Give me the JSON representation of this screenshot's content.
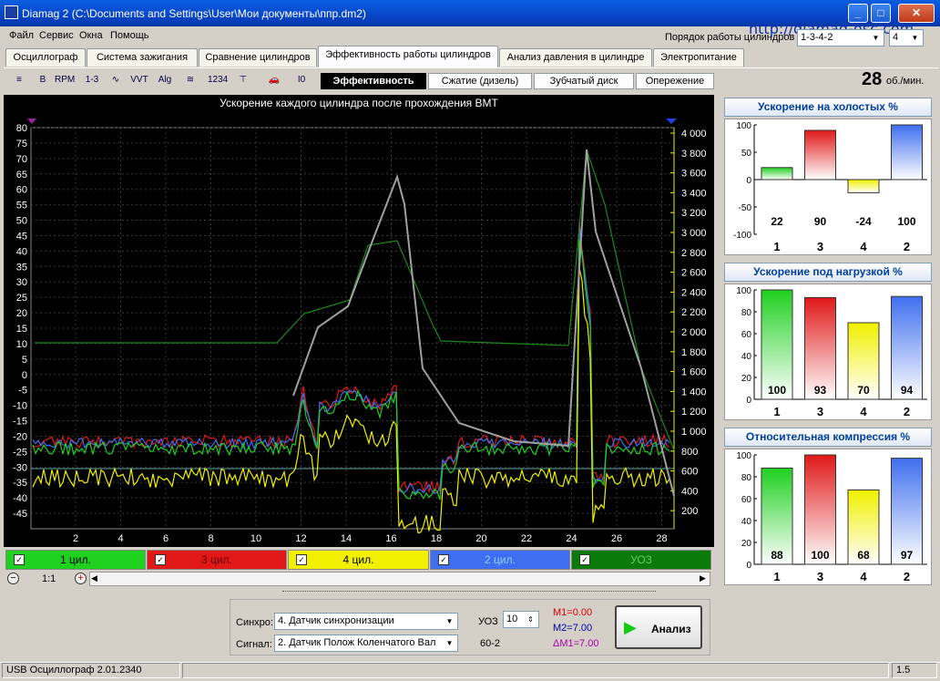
{
  "window": {
    "title": "Diamag 2 (C:\\Documents and Settings\\User\\Мои документы\\ппр.dm2)",
    "minimize": "_",
    "maximize": "□",
    "close": "✕"
  },
  "menu": [
    "Файл",
    "Сервис",
    "Окна",
    "Помощь"
  ],
  "site_link": "http://diamag-osc.com",
  "firing_order": {
    "label": "Порядок работы цилиндров",
    "value": "1-3-4-2",
    "count": "4"
  },
  "tabs": [
    "Осциллограф",
    "Система зажигания",
    "Сравнение цилиндров",
    "Эффективность работы цилиндров",
    "Анализ давления в цилиндре",
    "Электропитание"
  ],
  "active_tab": 3,
  "toolbar": {
    "tools": [
      "≡",
      "B",
      "RPM",
      "1-3",
      "∿",
      "VVT",
      "Alg",
      "≋",
      "1234",
      "⊤",
      "🚗",
      "I0"
    ]
  },
  "subtabs": [
    "Эффективность",
    "Сжатие (дизель)",
    "Зубчатый диск",
    "Опережение"
  ],
  "rpm": {
    "value": "28",
    "unit": "об./мин."
  },
  "plot": {
    "title": "Ускорение каждого цилиндра после прохождения ВМТ",
    "left_ticks": [
      "80",
      "75",
      "70",
      "65",
      "60",
      "55",
      "50",
      "45",
      "40",
      "35",
      "30",
      "25",
      "20",
      "15",
      "10",
      "5",
      "0",
      "-5",
      "-10",
      "-15",
      "-20",
      "-25",
      "-30",
      "-35",
      "-40",
      "-45"
    ],
    "right_ticks": [
      "4 000",
      "3 800",
      "3 600",
      "3 400",
      "3 200",
      "3 000",
      "2 800",
      "2 600",
      "2 400",
      "2 200",
      "2 000",
      "1 800",
      "1 600",
      "1 400",
      "1 200",
      "1 000",
      "800",
      "600",
      "400",
      "200"
    ],
    "x_ticks": [
      "2",
      "4",
      "6",
      "8",
      "10",
      "12",
      "14",
      "16",
      "18",
      "20",
      "22",
      "24",
      "26",
      "28"
    ]
  },
  "channels": [
    {
      "label": "1 цил.",
      "color": "#1fd01f"
    },
    {
      "label": "3 цил.",
      "color": "#e01818"
    },
    {
      "label": "4 цил.",
      "color": "#f0f000"
    },
    {
      "label": "2 цил.",
      "color": "#3f6ff0"
    },
    {
      "label": "УОЗ",
      "color": "#0a7a0a"
    }
  ],
  "zoom": "1:1",
  "controls": {
    "sync_label": "Синхро:",
    "sync_value": "4. Датчик синхронизации",
    "signal_label": "Сигнал:",
    "signal_value": "2. Датчик Полож Коленчатого Вал",
    "uoz_label": "УОЗ",
    "uoz_value": "10",
    "teeth": "60-2",
    "m1": "M1=0.00",
    "m2": "M2=7.00",
    "dm1": "ΔM1=7.00",
    "analyze": "Анализ"
  },
  "chart_data": [
    {
      "type": "bar",
      "title": "Ускорение на холостых %",
      "categories": [
        "1",
        "3",
        "4",
        "2"
      ],
      "values": [
        22,
        90,
        -24,
        100
      ],
      "ylim": [
        -100,
        100
      ],
      "yticks": [
        "100",
        "50",
        "0",
        "-50",
        "-100"
      ],
      "colors": [
        "#1fd01f",
        "#e01818",
        "#f0f000",
        "#3f6ff0"
      ]
    },
    {
      "type": "bar",
      "title": "Ускорение под нагрузкой %",
      "categories": [
        "1",
        "3",
        "4",
        "2"
      ],
      "values": [
        100,
        93,
        70,
        94
      ],
      "ylim": [
        0,
        100
      ],
      "yticks": [
        "100",
        "80",
        "60",
        "40",
        "20",
        "0"
      ],
      "colors": [
        "#1fd01f",
        "#e01818",
        "#f0f000",
        "#3f6ff0"
      ]
    },
    {
      "type": "bar",
      "title": "Относительная компрессия %",
      "categories": [
        "1",
        "3",
        "4",
        "2"
      ],
      "values": [
        88,
        100,
        68,
        97
      ],
      "ylim": [
        0,
        100
      ],
      "yticks": [
        "100",
        "80",
        "60",
        "40",
        "20",
        "0"
      ],
      "colors": [
        "#1fd01f",
        "#e01818",
        "#f0f000",
        "#3f6ff0"
      ]
    }
  ],
  "status": {
    "left": "USB Осциллограф  2.01.2340",
    "right": "1.5"
  }
}
